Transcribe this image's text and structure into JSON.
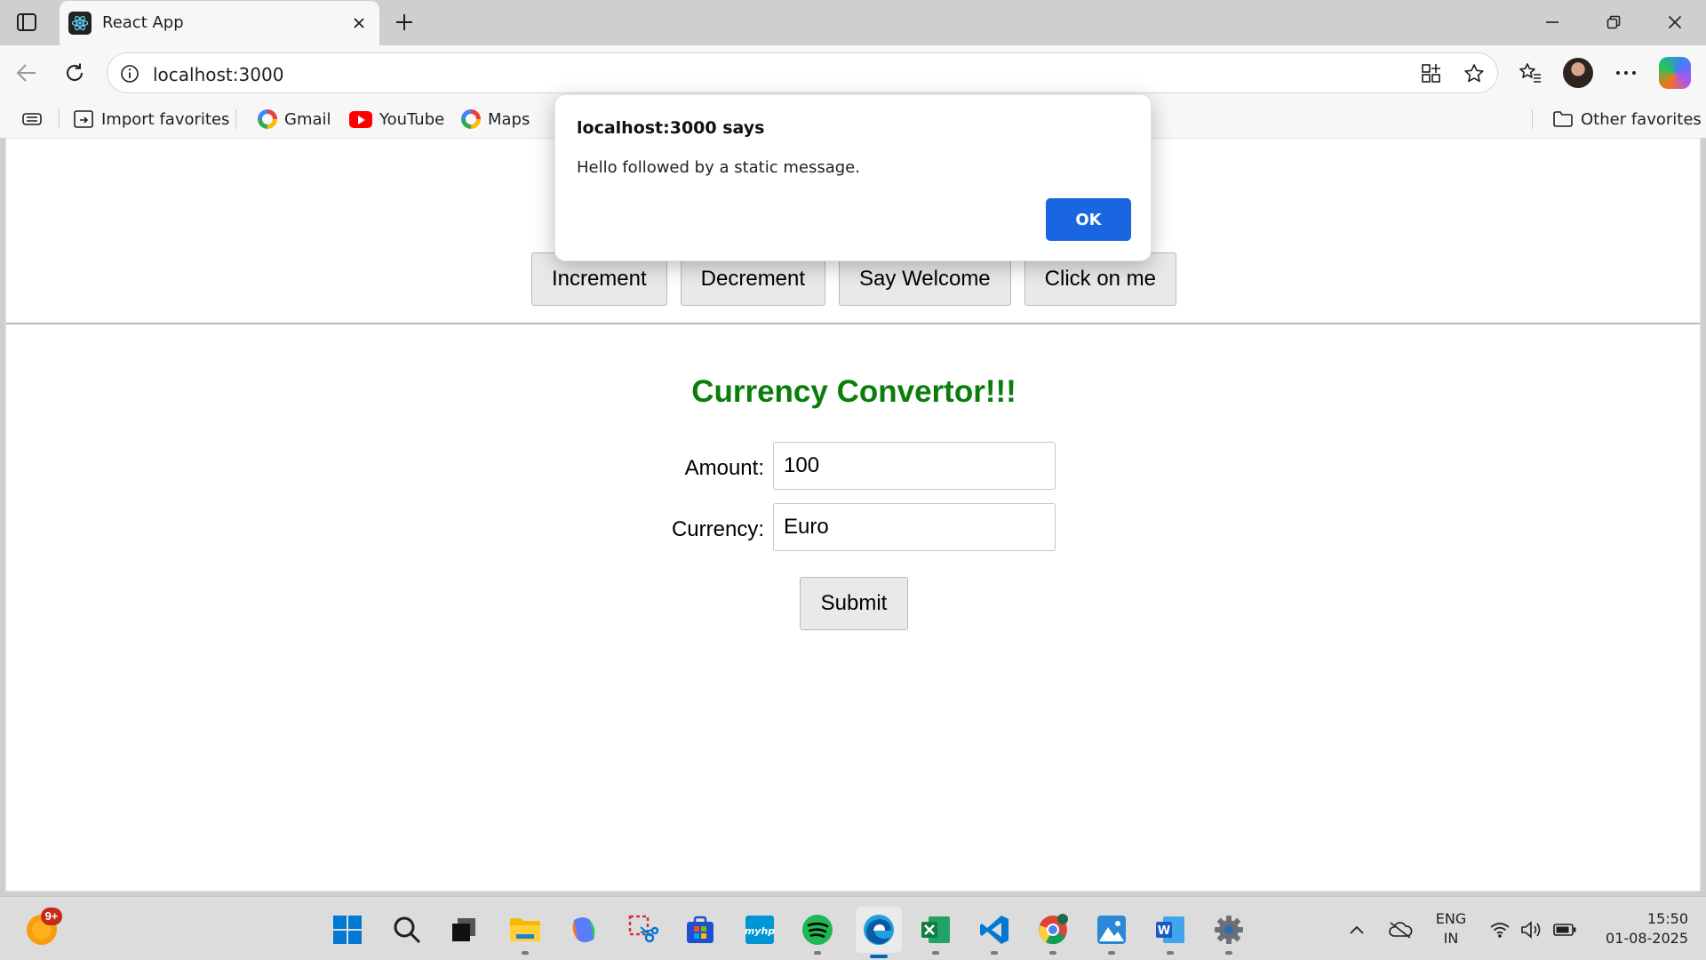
{
  "browser": {
    "tab_title": "React App",
    "url": "localhost:3000"
  },
  "favorites": {
    "import": "Import favorites",
    "items": [
      "Gmail",
      "YouTube",
      "Maps"
    ],
    "other": "Other favorites"
  },
  "page": {
    "buttons": [
      "Increment",
      "Decrement",
      "Say Welcome",
      "Click on me"
    ],
    "heading": "Currency Convertor!!!",
    "heading_color": "#0a7d0a",
    "amount_label": "Amount:",
    "amount_value": "100",
    "currency_label": "Currency:",
    "currency_value": "Euro",
    "submit_label": "Submit"
  },
  "dialog": {
    "title": "localhost:3000 says",
    "message": "Hello followed by a static message.",
    "ok_label": "OK",
    "ok_color": "#1a66e0"
  },
  "taskbar": {
    "notification_badge": "9+",
    "language": "ENG",
    "region": "IN",
    "time": "15:50",
    "date": "01-08-2025"
  }
}
